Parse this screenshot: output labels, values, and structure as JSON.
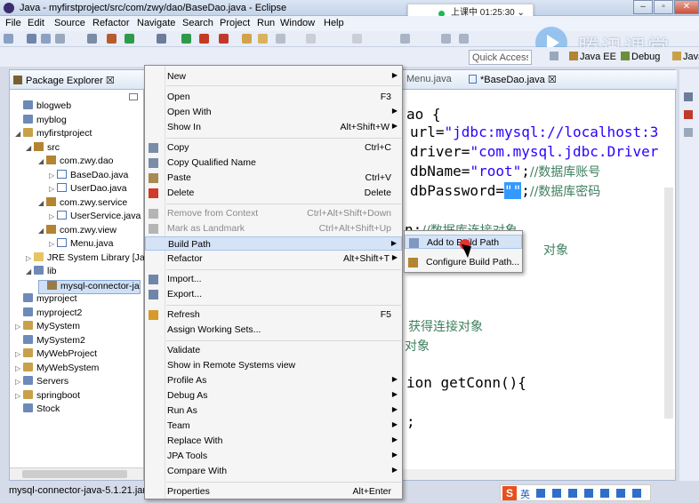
{
  "window": {
    "title": "Java - myfirstproject/src/com/zwy/dao/BaseDao.java - Eclipse"
  },
  "overlay": {
    "clock_text": "上课中 01:25:30 ⌄"
  },
  "watermark": {
    "text": "腾讯课堂"
  },
  "menubar": {
    "items": [
      "File",
      "Edit",
      "Source",
      "Refactor",
      "Navigate",
      "Search",
      "Project",
      "Run",
      "Window",
      "Help"
    ]
  },
  "toolbar2": {
    "quick_access": "Quick Access",
    "perspectives": [
      "Java EE",
      "Debug",
      "Java"
    ]
  },
  "package_explorer": {
    "tab_label": "Package Explorer ☒",
    "items": [
      {
        "label": "blogweb",
        "level": 0,
        "icon": "folder-icon",
        "arrow": ""
      },
      {
        "label": "myblog",
        "level": 0,
        "icon": "folder-icon",
        "arrow": ""
      },
      {
        "label": "myfirstproject",
        "level": 0,
        "icon": "project-icon",
        "arrow": "◢"
      },
      {
        "label": "src",
        "level": 1,
        "icon": "package-icon",
        "arrow": "◢"
      },
      {
        "label": "com.zwy.dao",
        "level": 2,
        "icon": "package-icon",
        "arrow": "◢"
      },
      {
        "label": "BaseDao.java",
        "level": 3,
        "icon": "java-file-icon",
        "arrow": "▷"
      },
      {
        "label": "UserDao.java",
        "level": 3,
        "icon": "java-file-icon",
        "arrow": "▷"
      },
      {
        "label": "com.zwy.service",
        "level": 2,
        "icon": "package-icon",
        "arrow": "◢"
      },
      {
        "label": "UserService.java",
        "level": 3,
        "icon": "java-file-icon",
        "arrow": "▷"
      },
      {
        "label": "com.zwy.view",
        "level": 2,
        "icon": "package-icon",
        "arrow": "◢"
      },
      {
        "label": "Menu.java",
        "level": 3,
        "icon": "java-file-icon",
        "arrow": "▷"
      },
      {
        "label": "JRE System Library [Ja",
        "level": 1,
        "icon": "library-icon",
        "arrow": "▷"
      },
      {
        "label": "lib",
        "level": 1,
        "icon": "folder-icon",
        "arrow": "◢"
      },
      {
        "label": "mysql-connector-ja",
        "level": 2,
        "icon": "jar-icon",
        "arrow": "",
        "selected": true
      },
      {
        "label": "myproject",
        "level": 0,
        "icon": "folder-icon",
        "arrow": ""
      },
      {
        "label": "myproject2",
        "level": 0,
        "icon": "folder-icon",
        "arrow": ""
      },
      {
        "label": "MySystem",
        "level": 0,
        "icon": "project-icon",
        "arrow": "▷"
      },
      {
        "label": "MySystem2",
        "level": 0,
        "icon": "folder-icon",
        "arrow": ""
      },
      {
        "label": "MyWebProject",
        "level": 0,
        "icon": "project-icon",
        "arrow": "▷"
      },
      {
        "label": "MyWebSystem",
        "level": 0,
        "icon": "project-icon",
        "arrow": "▷"
      },
      {
        "label": "Servers",
        "level": 0,
        "icon": "folder-icon",
        "arrow": "▷"
      },
      {
        "label": "springboot",
        "level": 0,
        "icon": "project-icon",
        "arrow": "▷"
      },
      {
        "label": "Stock",
        "level": 0,
        "icon": "folder-icon",
        "arrow": ""
      }
    ]
  },
  "status_bar": {
    "text": "mysql-connector-java-5.1.21.jar -"
  },
  "editor": {
    "tabs": [
      "Menu.java",
      "*BaseDao.java ☒"
    ],
    "code": {
      "line1": "ao {",
      "line2_kw": "url=",
      "line2_str": "\"jdbc:mysql://localhost:3",
      "line3_kw": "driver=",
      "line3_str": "\"com.mysql.jdbc.Driver",
      "line4_kw": "dbName=",
      "line4_str": "\"root\"",
      "line4_semicolon": ";",
      "line4_comment": "//数据库账号",
      "line5_kw": "dbPassword=",
      "line5_sel": "\"\"",
      "line5_semicolon": ";",
      "line5_comment": "//数据库密码",
      "line6_code": "n;",
      "line6_comment": "//数据库连接对象",
      "line7_comment": "对象",
      "line8_comment": "获得连接对象",
      "line9_comment": "对象",
      "line10": "ion getConn(){",
      "line11": ";"
    }
  },
  "context_menu": {
    "items": [
      {
        "label": "New",
        "accel": "",
        "submenu": true,
        "disabled": false
      },
      {
        "label": "Open",
        "accel": "F3",
        "submenu": false,
        "disabled": false
      },
      {
        "label": "Open With",
        "accel": "",
        "submenu": true,
        "disabled": false
      },
      {
        "label": "Show In",
        "accel": "Alt+Shift+W",
        "submenu": true,
        "disabled": false
      },
      {
        "label": "Copy",
        "accel": "Ctrl+C",
        "submenu": false,
        "disabled": false
      },
      {
        "label": "Copy Qualified Name",
        "accel": "",
        "submenu": false,
        "disabled": false
      },
      {
        "label": "Paste",
        "accel": "Ctrl+V",
        "submenu": false,
        "disabled": false
      },
      {
        "label": "Delete",
        "accel": "Delete",
        "submenu": false,
        "disabled": false
      },
      {
        "label": "Remove from Context",
        "accel": "Ctrl+Alt+Shift+Down",
        "submenu": false,
        "disabled": true
      },
      {
        "label": "Mark as Landmark",
        "accel": "Ctrl+Alt+Shift+Up",
        "submenu": false,
        "disabled": true
      },
      {
        "label": "Build Path",
        "accel": "",
        "submenu": true,
        "disabled": false
      },
      {
        "label": "Refactor",
        "accel": "Alt+Shift+T",
        "submenu": true,
        "disabled": false
      },
      {
        "label": "Import...",
        "accel": "",
        "submenu": false,
        "disabled": false
      },
      {
        "label": "Export...",
        "accel": "",
        "submenu": false,
        "disabled": false
      },
      {
        "label": "Refresh",
        "accel": "F5",
        "submenu": false,
        "disabled": false
      },
      {
        "label": "Assign Working Sets...",
        "accel": "",
        "submenu": false,
        "disabled": false
      },
      {
        "label": "Validate",
        "accel": "",
        "submenu": false,
        "disabled": false
      },
      {
        "label": "Show in Remote Systems view",
        "accel": "",
        "submenu": false,
        "disabled": false
      },
      {
        "label": "Profile As",
        "accel": "",
        "submenu": true,
        "disabled": false
      },
      {
        "label": "Debug As",
        "accel": "",
        "submenu": true,
        "disabled": false
      },
      {
        "label": "Run As",
        "accel": "",
        "submenu": true,
        "disabled": false
      },
      {
        "label": "Team",
        "accel": "",
        "submenu": true,
        "disabled": false
      },
      {
        "label": "Replace With",
        "accel": "",
        "submenu": true,
        "disabled": false
      },
      {
        "label": "JPA Tools",
        "accel": "",
        "submenu": true,
        "disabled": false
      },
      {
        "label": "Compare With",
        "accel": "",
        "submenu": true,
        "disabled": false
      },
      {
        "label": "Properties",
        "accel": "Alt+Enter",
        "submenu": false,
        "disabled": false
      }
    ]
  },
  "build_path_submenu": {
    "items": [
      "Add to Build Path",
      "Configure Build Path..."
    ]
  },
  "ime": {
    "text": "英"
  },
  "colors": {
    "accent_blue": "#3399ff",
    "string_blue": "#2a00ff",
    "comment_green": "#3f7f5f",
    "menu_hover": "#d5e3f7"
  }
}
